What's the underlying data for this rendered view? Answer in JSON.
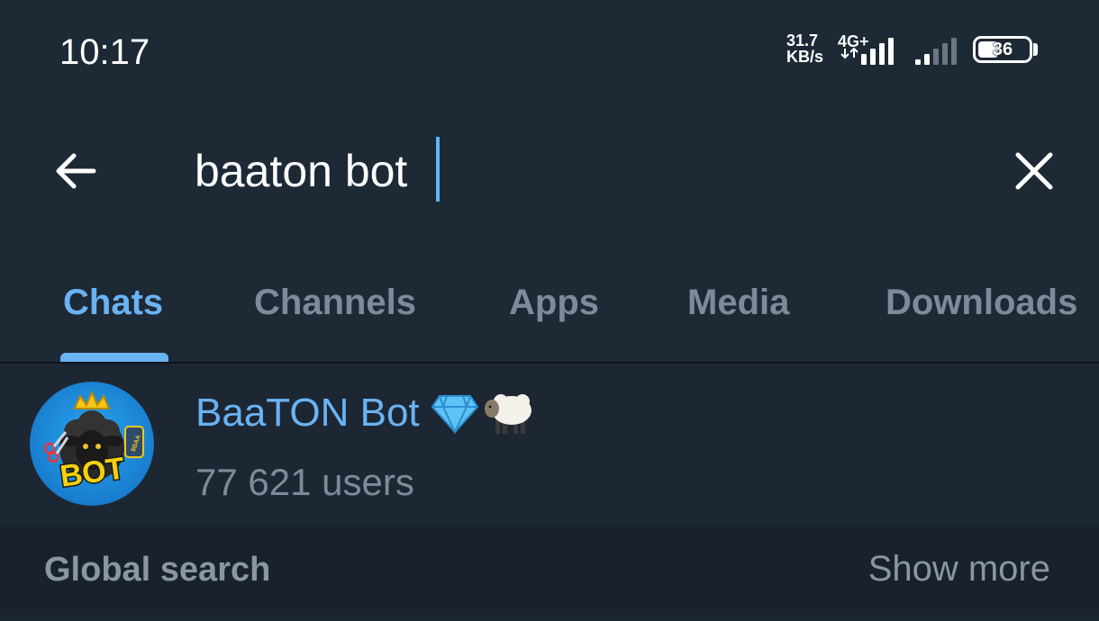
{
  "status_bar": {
    "time": "10:17",
    "net_speed_value": "31.7",
    "net_speed_unit": "KB/s",
    "network_type": "4G+",
    "battery_level": "36"
  },
  "search": {
    "query": "baaton bot",
    "back_icon": "arrow-left-icon",
    "clear_icon": "close-icon"
  },
  "tabs": [
    {
      "label": "Chats",
      "active": true
    },
    {
      "label": "Channels",
      "active": false
    },
    {
      "label": "Apps",
      "active": false
    },
    {
      "label": "Media",
      "active": false
    },
    {
      "label": "Downloads",
      "active": false
    }
  ],
  "results": [
    {
      "name": "BaaTON Bot",
      "badges": [
        "💎",
        "🐑"
      ],
      "subtitle": "77 621 users",
      "avatar_text": "BOT",
      "avatar_side_text": "$BAA"
    }
  ],
  "global_search": {
    "title": "Global search",
    "show_more": "Show more"
  },
  "colors": {
    "background": "#1d2733",
    "header": "#1e2936",
    "accent": "#6ab3f3",
    "muted_text": "#7d8b99",
    "section_header": "#18212c"
  }
}
